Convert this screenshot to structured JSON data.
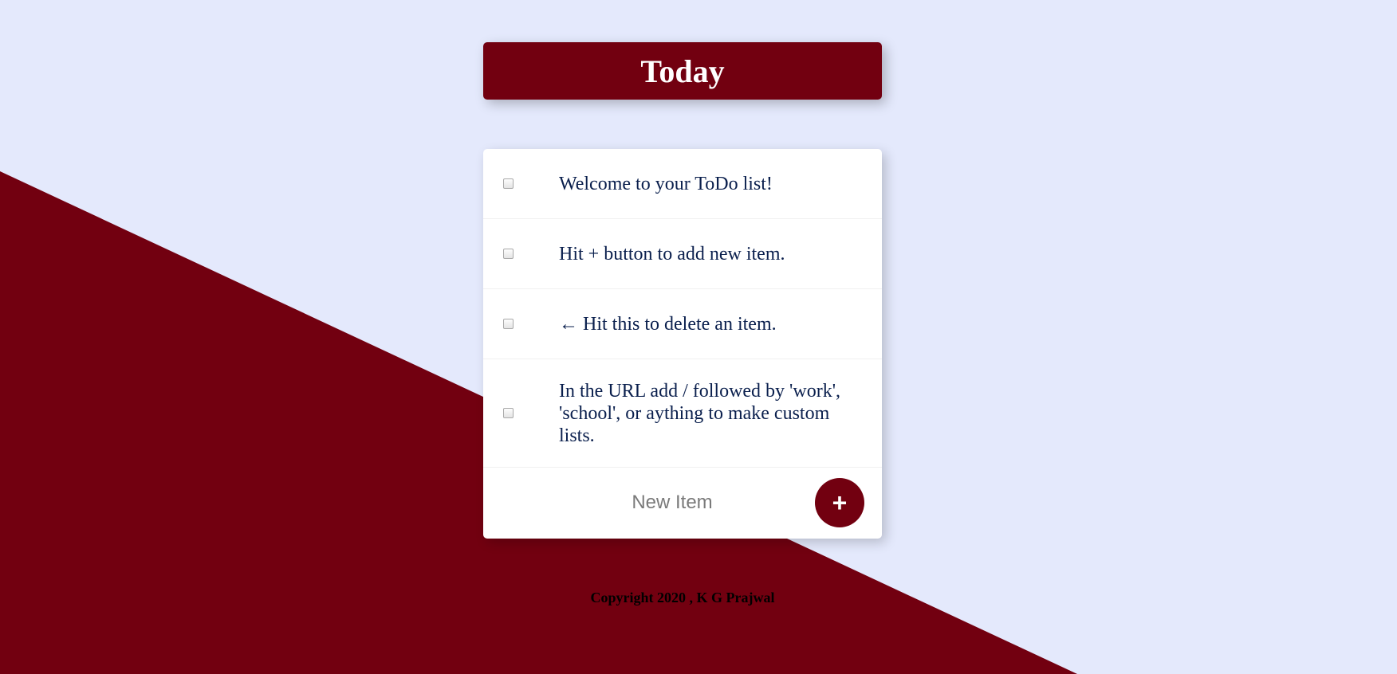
{
  "colors": {
    "background": "#E4E9FC",
    "accent": "#720010",
    "item_text": "#0A1F4D",
    "card": "#FFFFFF"
  },
  "heading": {
    "title": "Today"
  },
  "items": [
    {
      "text": "Welcome to your ToDo list!",
      "checked": false
    },
    {
      "text": "Hit + button to add new item.",
      "checked": false
    },
    {
      "text": "← Hit this to delete an item.",
      "checked": false
    },
    {
      "text": "In the URL add / followed by 'work', 'school', or aything to make custom lists.",
      "checked": false
    }
  ],
  "new_item": {
    "placeholder": "New Item",
    "value": ""
  },
  "add_button": {
    "label": "+",
    "icon": "plus-icon"
  },
  "footer": {
    "text": "Copyright 2020 , K G Prajwal"
  }
}
